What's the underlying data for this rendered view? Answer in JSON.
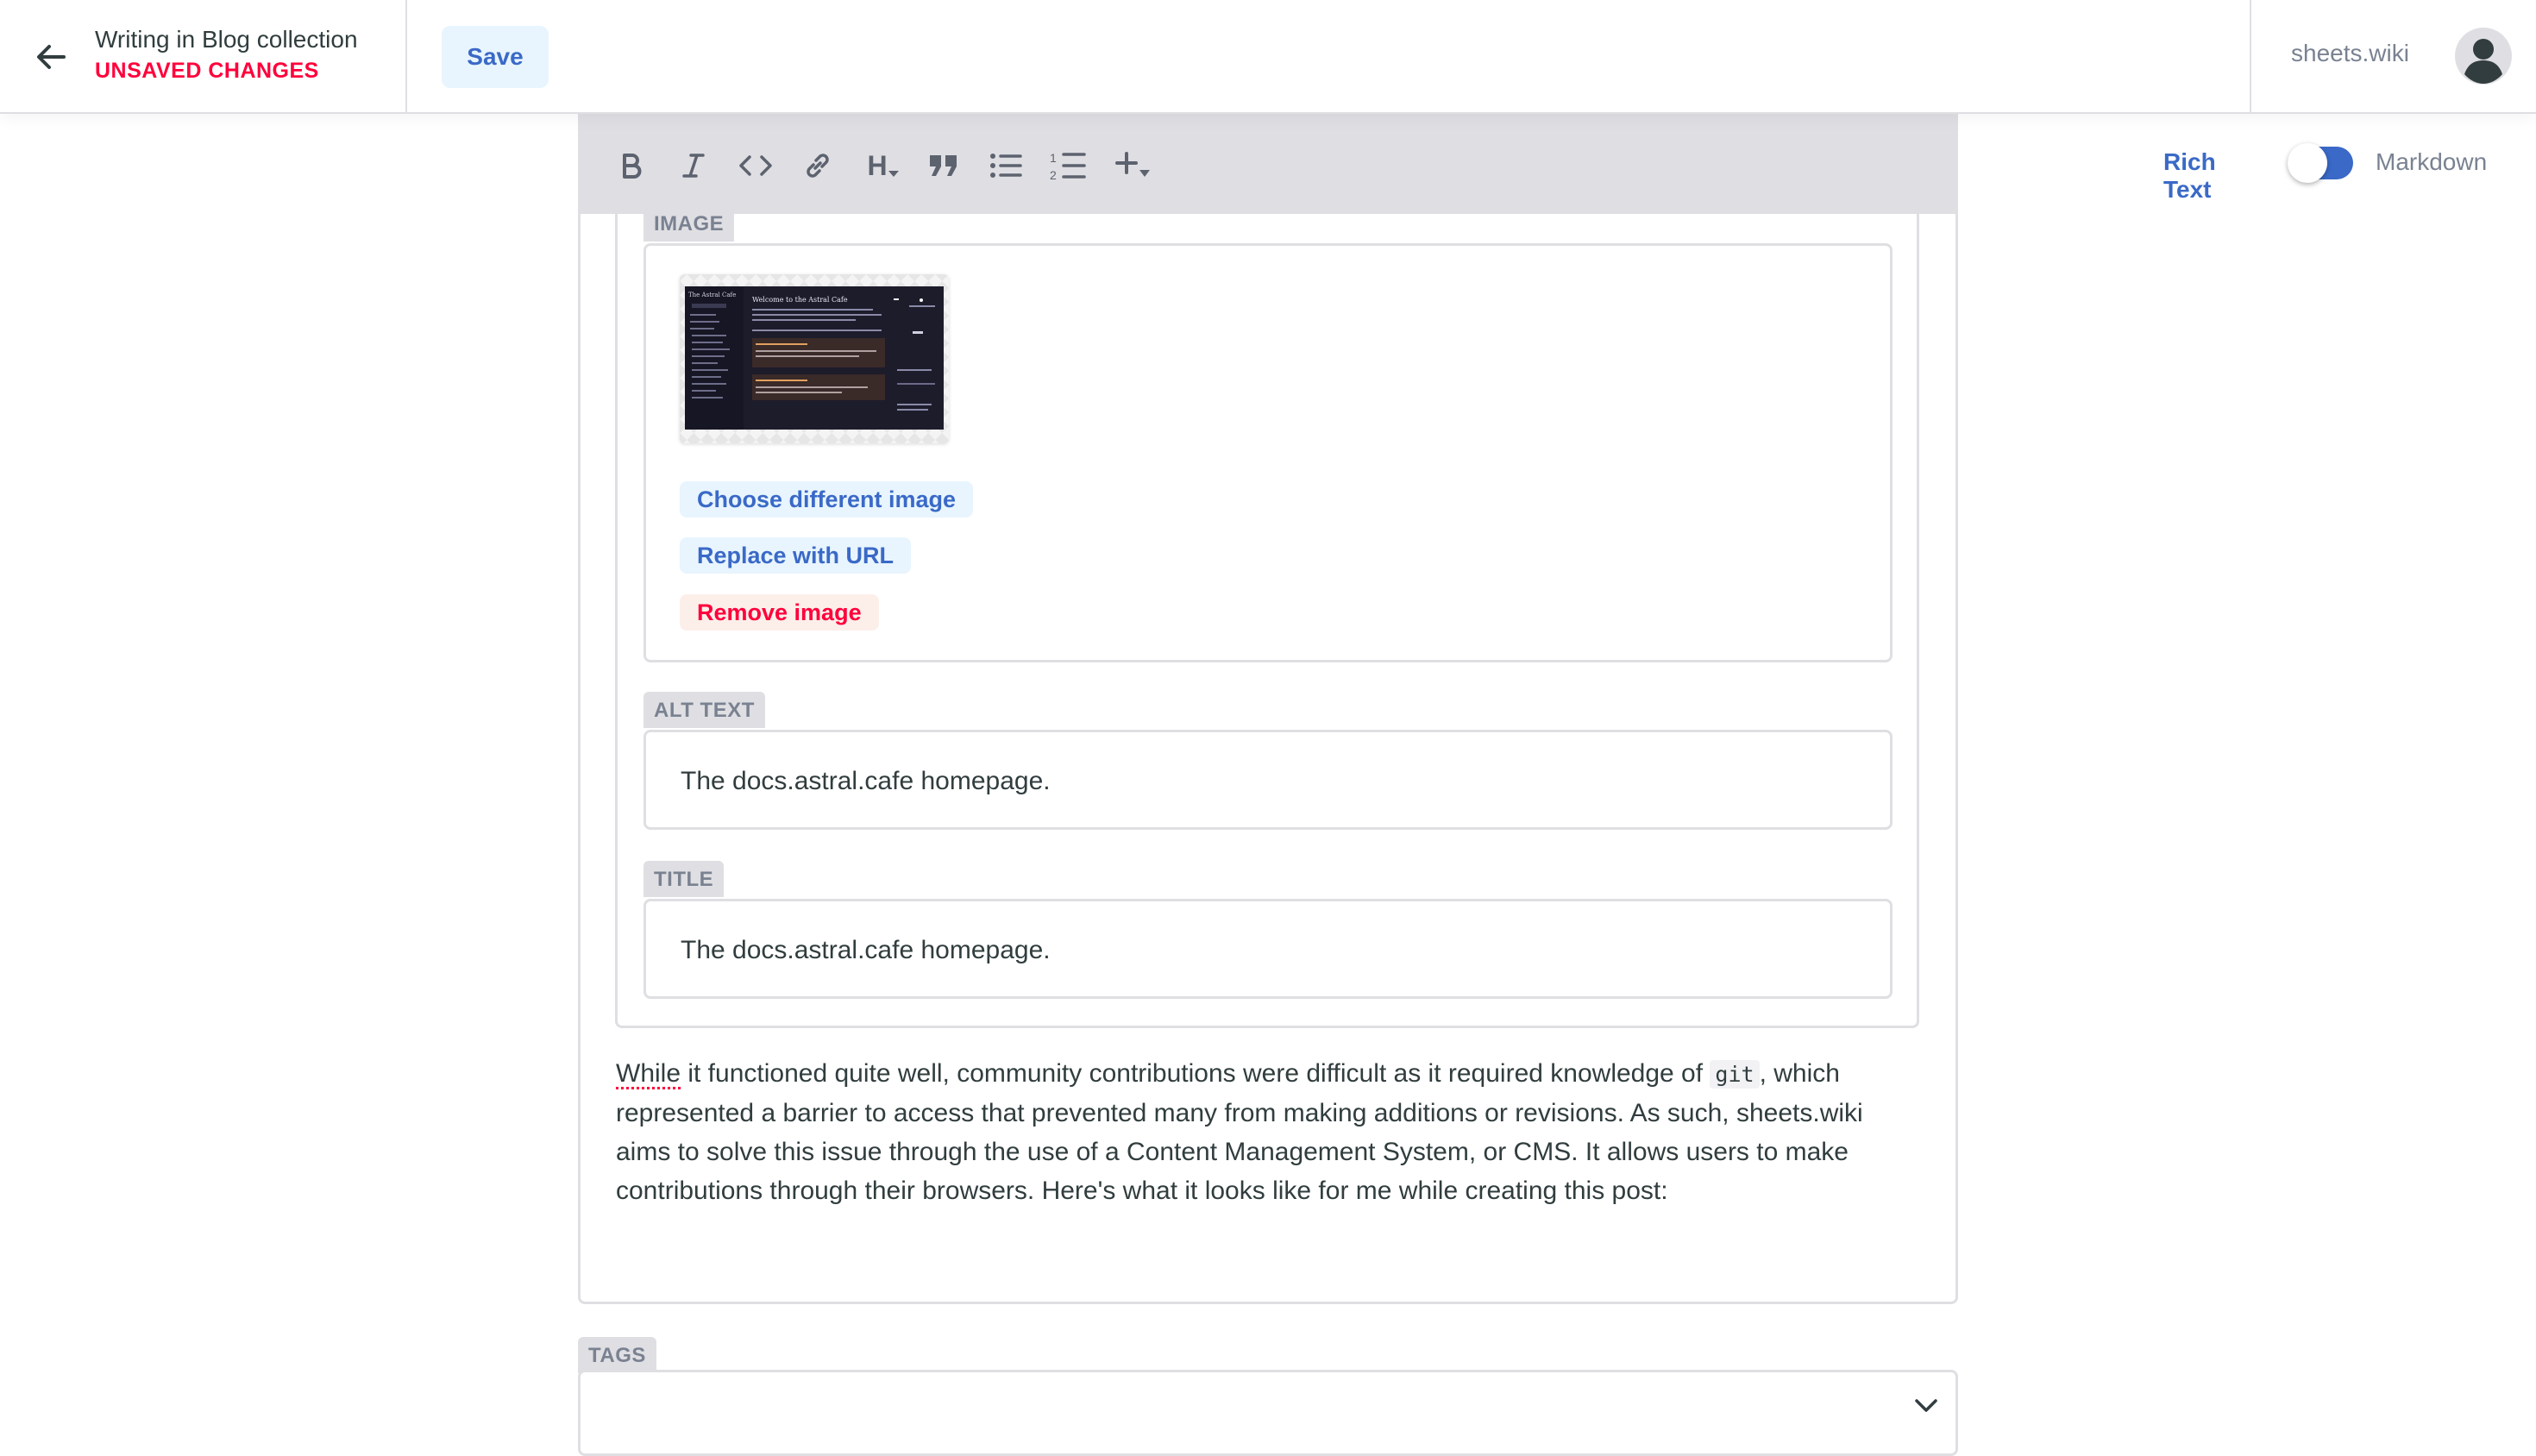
{
  "header": {
    "title": "Writing in Blog collection",
    "status": "UNSAVED CHANGES",
    "save_label": "Save",
    "site_name": "sheets.wiki"
  },
  "toolbar": {
    "buttons": [
      "bold-icon",
      "italic-icon",
      "code-icon",
      "link-icon",
      "heading-icon",
      "quote-icon",
      "bulleted-list-icon",
      "numbered-list-icon",
      "add-component-icon"
    ],
    "heading_glyph": "H",
    "rich_text_label": "Rich Text",
    "markdown_label": "Markdown",
    "mode_rich_text_on": true
  },
  "image_block": {
    "image_label": "IMAGE",
    "choose_label": "Choose different image",
    "replace_label": "Replace with URL",
    "remove_label": "Remove image",
    "alt_label": "ALT TEXT",
    "alt_value": "The docs.astral.cafe homepage.",
    "title_label": "TITLE",
    "title_value": "The docs.astral.cafe homepage."
  },
  "thumbnail": {
    "site_title": "The Astral Cafe",
    "heading": "Welcome to the Astral Cafe"
  },
  "body": {
    "p_word1": "While",
    "p_part1": " it functioned quite well, community contributions were difficult as it required knowledge of ",
    "p_code": "git",
    "p_part2": ", which represented a barrier to access that prevented many from making additions or revisions. As such, sheets.wiki aims to solve this issue through the use of a Content Management System, or CMS. It allows users to make contributions through their browsers. Here's what it looks like for me while creating this post:"
  },
  "tags": {
    "label": "TAGS"
  },
  "colors": {
    "accent": "#3a69c7",
    "danger": "#ff003b",
    "border": "#dfdfe3",
    "text": "#313d3e"
  }
}
